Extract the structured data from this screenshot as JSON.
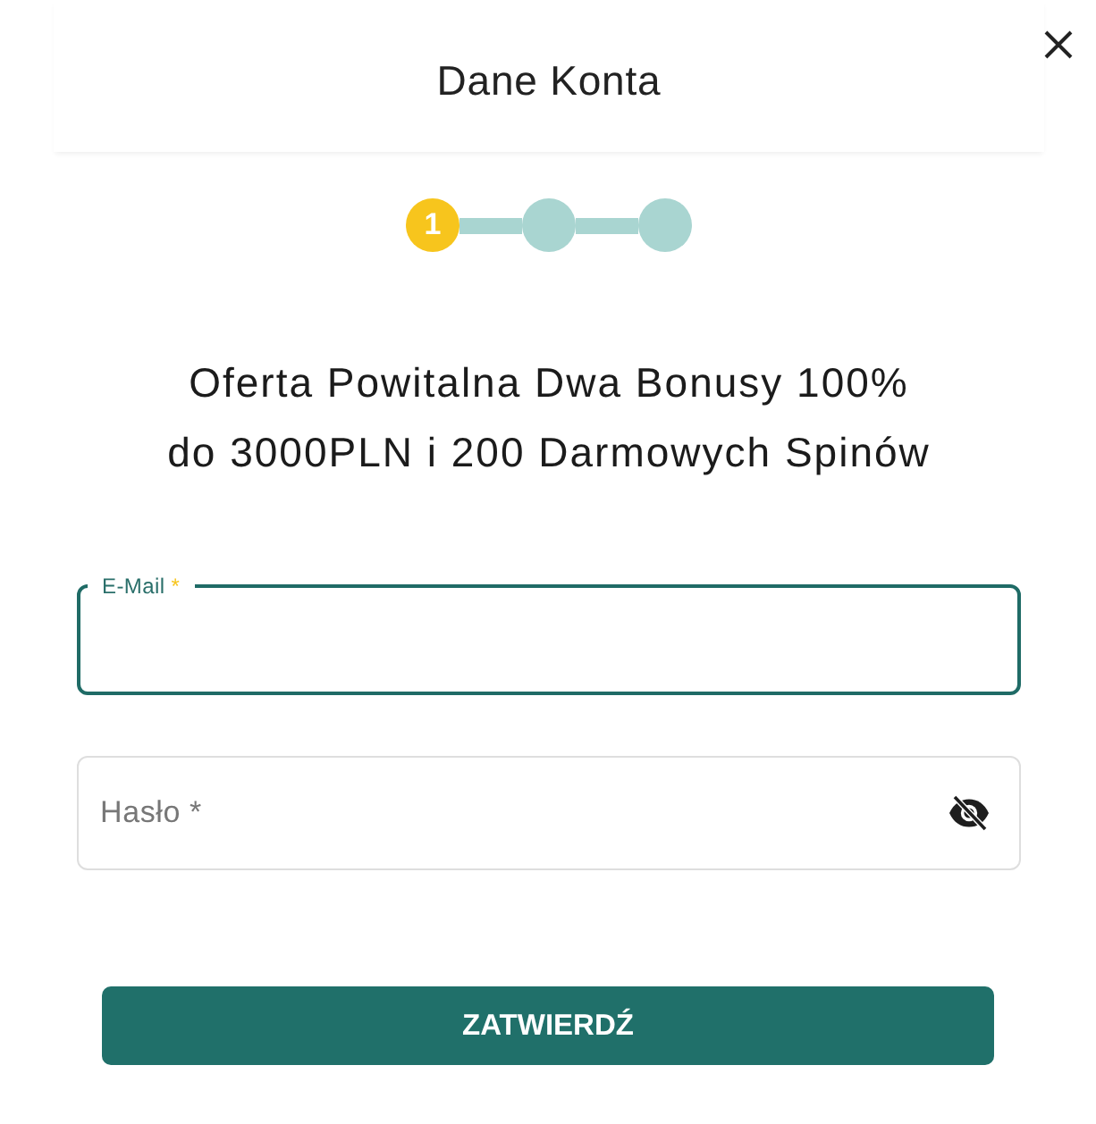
{
  "window": {
    "title": "Dane Konta"
  },
  "stepper": {
    "steps": [
      {
        "label": "1",
        "selected": true
      },
      {
        "selected": false
      },
      {
        "selected": false
      }
    ]
  },
  "headline": {
    "lines": [
      "Oferta Powitalna Dwa Bonusy 100%",
      "do 3000PLN i 200 Darmowych Spinów"
    ]
  },
  "fields": [
    {
      "kind": "email",
      "label": "E-Mail",
      "required_mark": "*",
      "focused": true
    },
    {
      "kind": "password",
      "placeholder": "Hasło *",
      "focused": false,
      "masked": true
    }
  ],
  "submit_button": {
    "label": "ZATWIERDŹ"
  }
}
